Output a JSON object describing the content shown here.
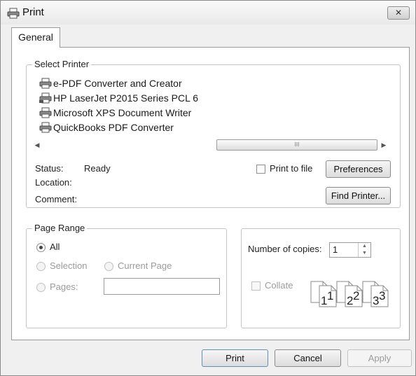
{
  "window": {
    "title": "Print",
    "close_glyph": "✕"
  },
  "tabs": [
    {
      "label": "General"
    }
  ],
  "select_printer": {
    "group_label": "Select Printer",
    "printers": [
      {
        "name": "e-PDF Converter and Creator",
        "icon": "printer-icon"
      },
      {
        "name": "HP LaserJet P2015 Series PCL 6",
        "icon": "network-printer-icon"
      },
      {
        "name": "Microsoft XPS Document Writer",
        "icon": "printer-icon"
      },
      {
        "name": "QuickBooks PDF Converter",
        "icon": "printer-icon"
      }
    ],
    "scroll_thumb_glyph": "III",
    "status_label": "Status:",
    "status_value": "Ready",
    "location_label": "Location:",
    "location_value": "",
    "comment_label": "Comment:",
    "comment_value": "",
    "print_to_file_label": "Print to file",
    "print_to_file_checked": false,
    "preferences_label": "Preferences",
    "find_printer_label": "Find Printer..."
  },
  "page_range": {
    "group_label": "Page Range",
    "all_label": "All",
    "all_checked": true,
    "selection_label": "Selection",
    "current_page_label": "Current Page",
    "pages_label": "Pages:",
    "pages_value": ""
  },
  "copies": {
    "number_label": "Number of copies:",
    "number_value": "1",
    "collate_label": "Collate",
    "collate_checked": false,
    "collate_pages": [
      "1",
      "1",
      "2",
      "2",
      "3",
      "3"
    ]
  },
  "footer": {
    "print_label": "Print",
    "cancel_label": "Cancel",
    "apply_label": "Apply"
  }
}
